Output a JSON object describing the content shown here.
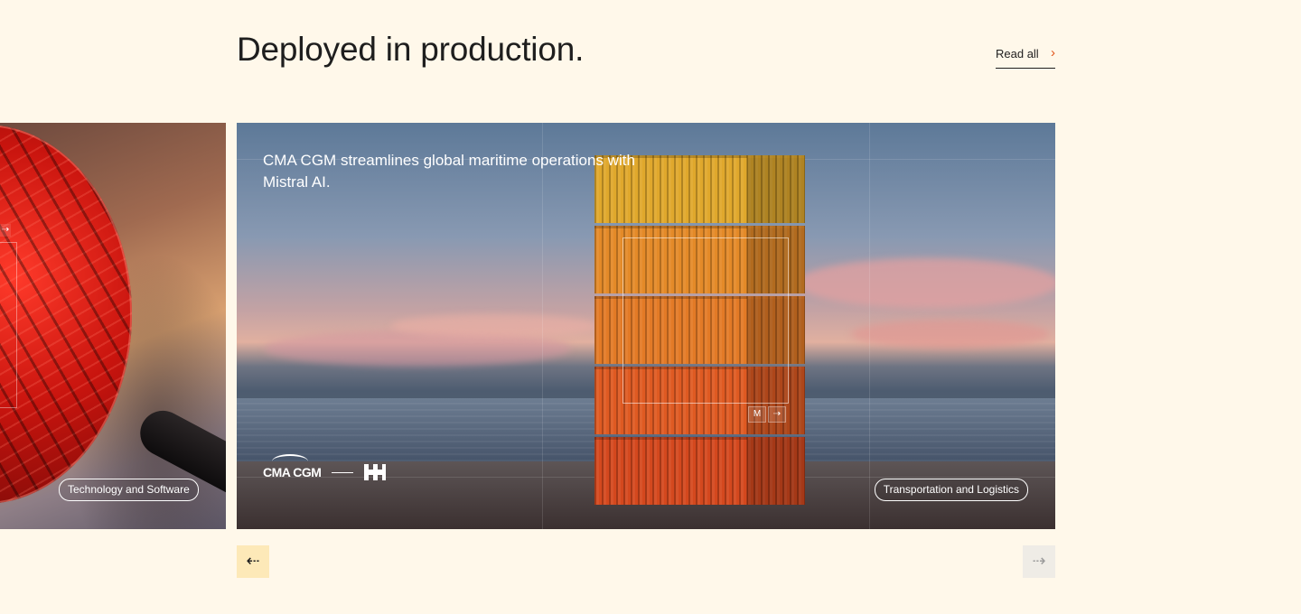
{
  "section": {
    "heading": "Deployed in production.",
    "read_all_label": "Read all",
    "read_all_icon": "chevron-right-icon"
  },
  "cards": [
    {
      "tag": "Technology and Software",
      "visual": "red-silicon-wafer"
    },
    {
      "title": "CMA CGM streamlines global maritime operations with Mistral AI.",
      "partner_logo": "CMA CGM",
      "tag": "Transportation and Logistics",
      "visual": "stacked-shipping-containers"
    }
  ],
  "carousel": {
    "prev_icon": "arrow-left-icon",
    "next_icon": "arrow-right-icon",
    "prev_glyph": "⇠",
    "next_glyph": "⇢",
    "mini_arrow": "⇢"
  },
  "colors": {
    "background": "#fff8ea",
    "prev_button_bg": "#fde9b8",
    "next_button_bg": "#efece6",
    "accent": "#e0541a"
  }
}
